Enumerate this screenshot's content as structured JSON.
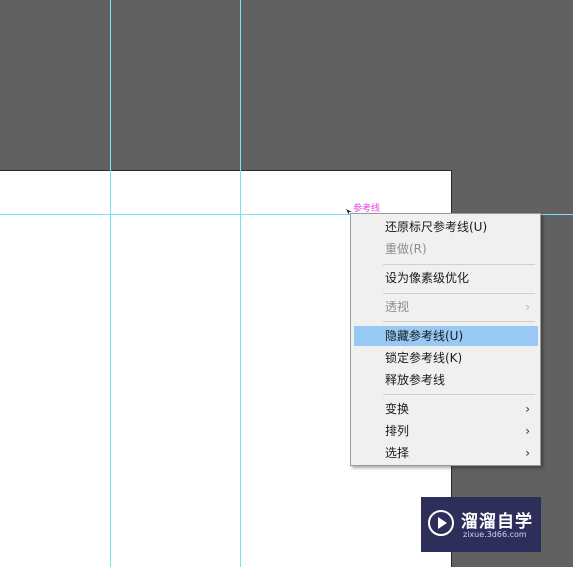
{
  "guide_label": "参考线",
  "context_menu": {
    "items": [
      {
        "label": "还原标尺参考线(U)",
        "disabled": false,
        "submenu": false
      },
      {
        "label": "重做(R)",
        "disabled": true,
        "submenu": false
      },
      {
        "label": "设为像素级优化",
        "disabled": false,
        "submenu": false
      },
      {
        "label": "透视",
        "disabled": true,
        "submenu": true,
        "arrow": "›"
      },
      {
        "label": "隐藏参考线(U)",
        "disabled": false,
        "submenu": false,
        "highlighted": true
      },
      {
        "label": "锁定参考线(K)",
        "disabled": false,
        "submenu": false
      },
      {
        "label": "释放参考线",
        "disabled": false,
        "submenu": false
      },
      {
        "label": "变换",
        "disabled": false,
        "submenu": true,
        "arrow": "›"
      },
      {
        "label": "排列",
        "disabled": false,
        "submenu": true,
        "arrow": "›"
      },
      {
        "label": "选择",
        "disabled": false,
        "submenu": true,
        "arrow": "›"
      }
    ]
  },
  "watermark": {
    "title": "溜溜自学",
    "subtitle": "zixue.3d66.com"
  },
  "colors": {
    "pasteboard": "#616161",
    "guide": "#74e5f1",
    "highlight": "#98c8f4",
    "guide_label": "#e640e6"
  }
}
